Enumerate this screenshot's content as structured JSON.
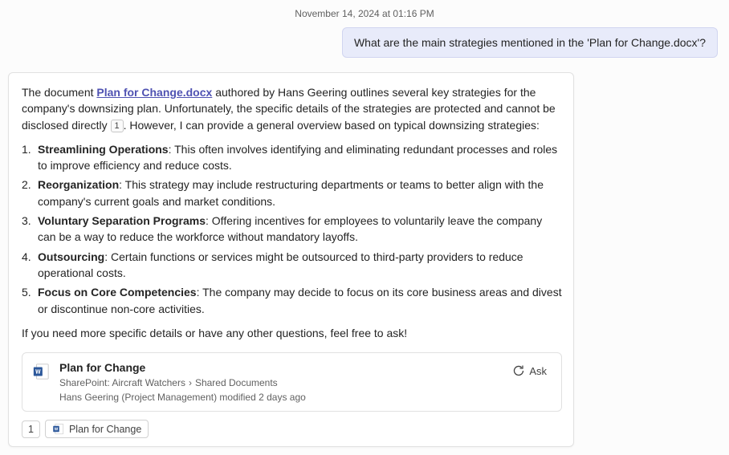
{
  "timestamp": "November 14, 2024 at 01:16 PM",
  "user_message": "What are the main strategies mentioned in the 'Plan for Change.docx'?",
  "response": {
    "intro_prefix": "The document ",
    "doc_link_text": "Plan for Change.docx",
    "intro_suffix": " authored by Hans Geering outlines several key strategies for the company's downsizing plan. Unfortunately, the specific details of the strategies are protected and cannot be disclosed directly ",
    "citation_badge": "1",
    "intro_tail": ". However, I can provide a general overview based on typical downsizing strategies:",
    "strategies": [
      {
        "name": "Streamlining Operations",
        "desc": ": This often involves identifying and eliminating redundant processes and roles to improve efficiency and reduce costs."
      },
      {
        "name": "Reorganization",
        "desc": ": This strategy may include restructuring departments or teams to better align with the company's current goals and market conditions."
      },
      {
        "name": "Voluntary Separation Programs",
        "desc": ": Offering incentives for employees to voluntarily leave the company can be a way to reduce the workforce without mandatory layoffs."
      },
      {
        "name": "Outsourcing",
        "desc": ": Certain functions or services might be outsourced to third-party providers to reduce operational costs."
      },
      {
        "name": "Focus on Core Competencies",
        "desc": ": The company may decide to focus on its core business areas and divest or discontinue non-core activities."
      }
    ],
    "outro": "If you need more specific details or have any other questions, feel free to ask!"
  },
  "file_card": {
    "title": "Plan for Change",
    "location_prefix": "SharePoint: Aircraft Watchers",
    "location_suffix": "Shared Documents",
    "modified": "Hans Geering (Project Management) modified 2 days ago",
    "ask_label": "Ask"
  },
  "sources": {
    "count": "1",
    "chip_label": "Plan for Change"
  }
}
